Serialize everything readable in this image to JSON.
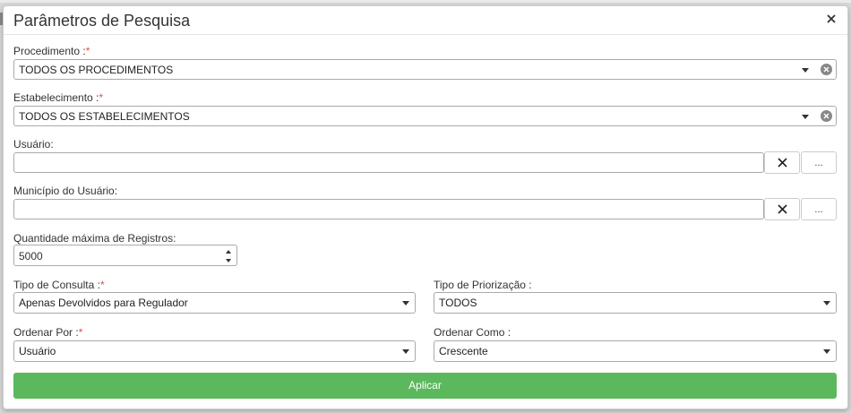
{
  "dialog": {
    "title": "Parâmetros de Pesquisa"
  },
  "procedimento": {
    "label": "Procedimento :",
    "required_mark": "*",
    "value": "TODOS OS PROCEDIMENTOS"
  },
  "estabelecimento": {
    "label": "Estabelecimento :",
    "required_mark": "*",
    "value": "TODOS OS ESTABELECIMENTOS"
  },
  "usuario": {
    "label": "Usuário:",
    "value": "",
    "browse_label": "..."
  },
  "municipio": {
    "label": "Município do Usuário:",
    "value": "",
    "browse_label": "..."
  },
  "quantidade": {
    "label": "Quantidade máxima de Registros:",
    "value": "5000"
  },
  "tipo_consulta": {
    "label": "Tipo de Consulta :",
    "required_mark": "*",
    "value": "Apenas Devolvidos para Regulador"
  },
  "tipo_priorizacao": {
    "label": "Tipo de Priorização :",
    "value": "TODOS"
  },
  "ordenar_por": {
    "label": "Ordenar Por :",
    "required_mark": "*",
    "value": "Usuário"
  },
  "ordenar_como": {
    "label": "Ordenar Como :",
    "value": "Crescente"
  },
  "actions": {
    "apply_label": "Aplicar",
    "apply_color": "#5cb85c"
  },
  "icons": {
    "close": "close-icon",
    "dropdown": "chevron-down-icon",
    "clear": "clear-circle-icon",
    "clear_field": "x-icon",
    "spinner": "spinner-arrows-icon"
  }
}
